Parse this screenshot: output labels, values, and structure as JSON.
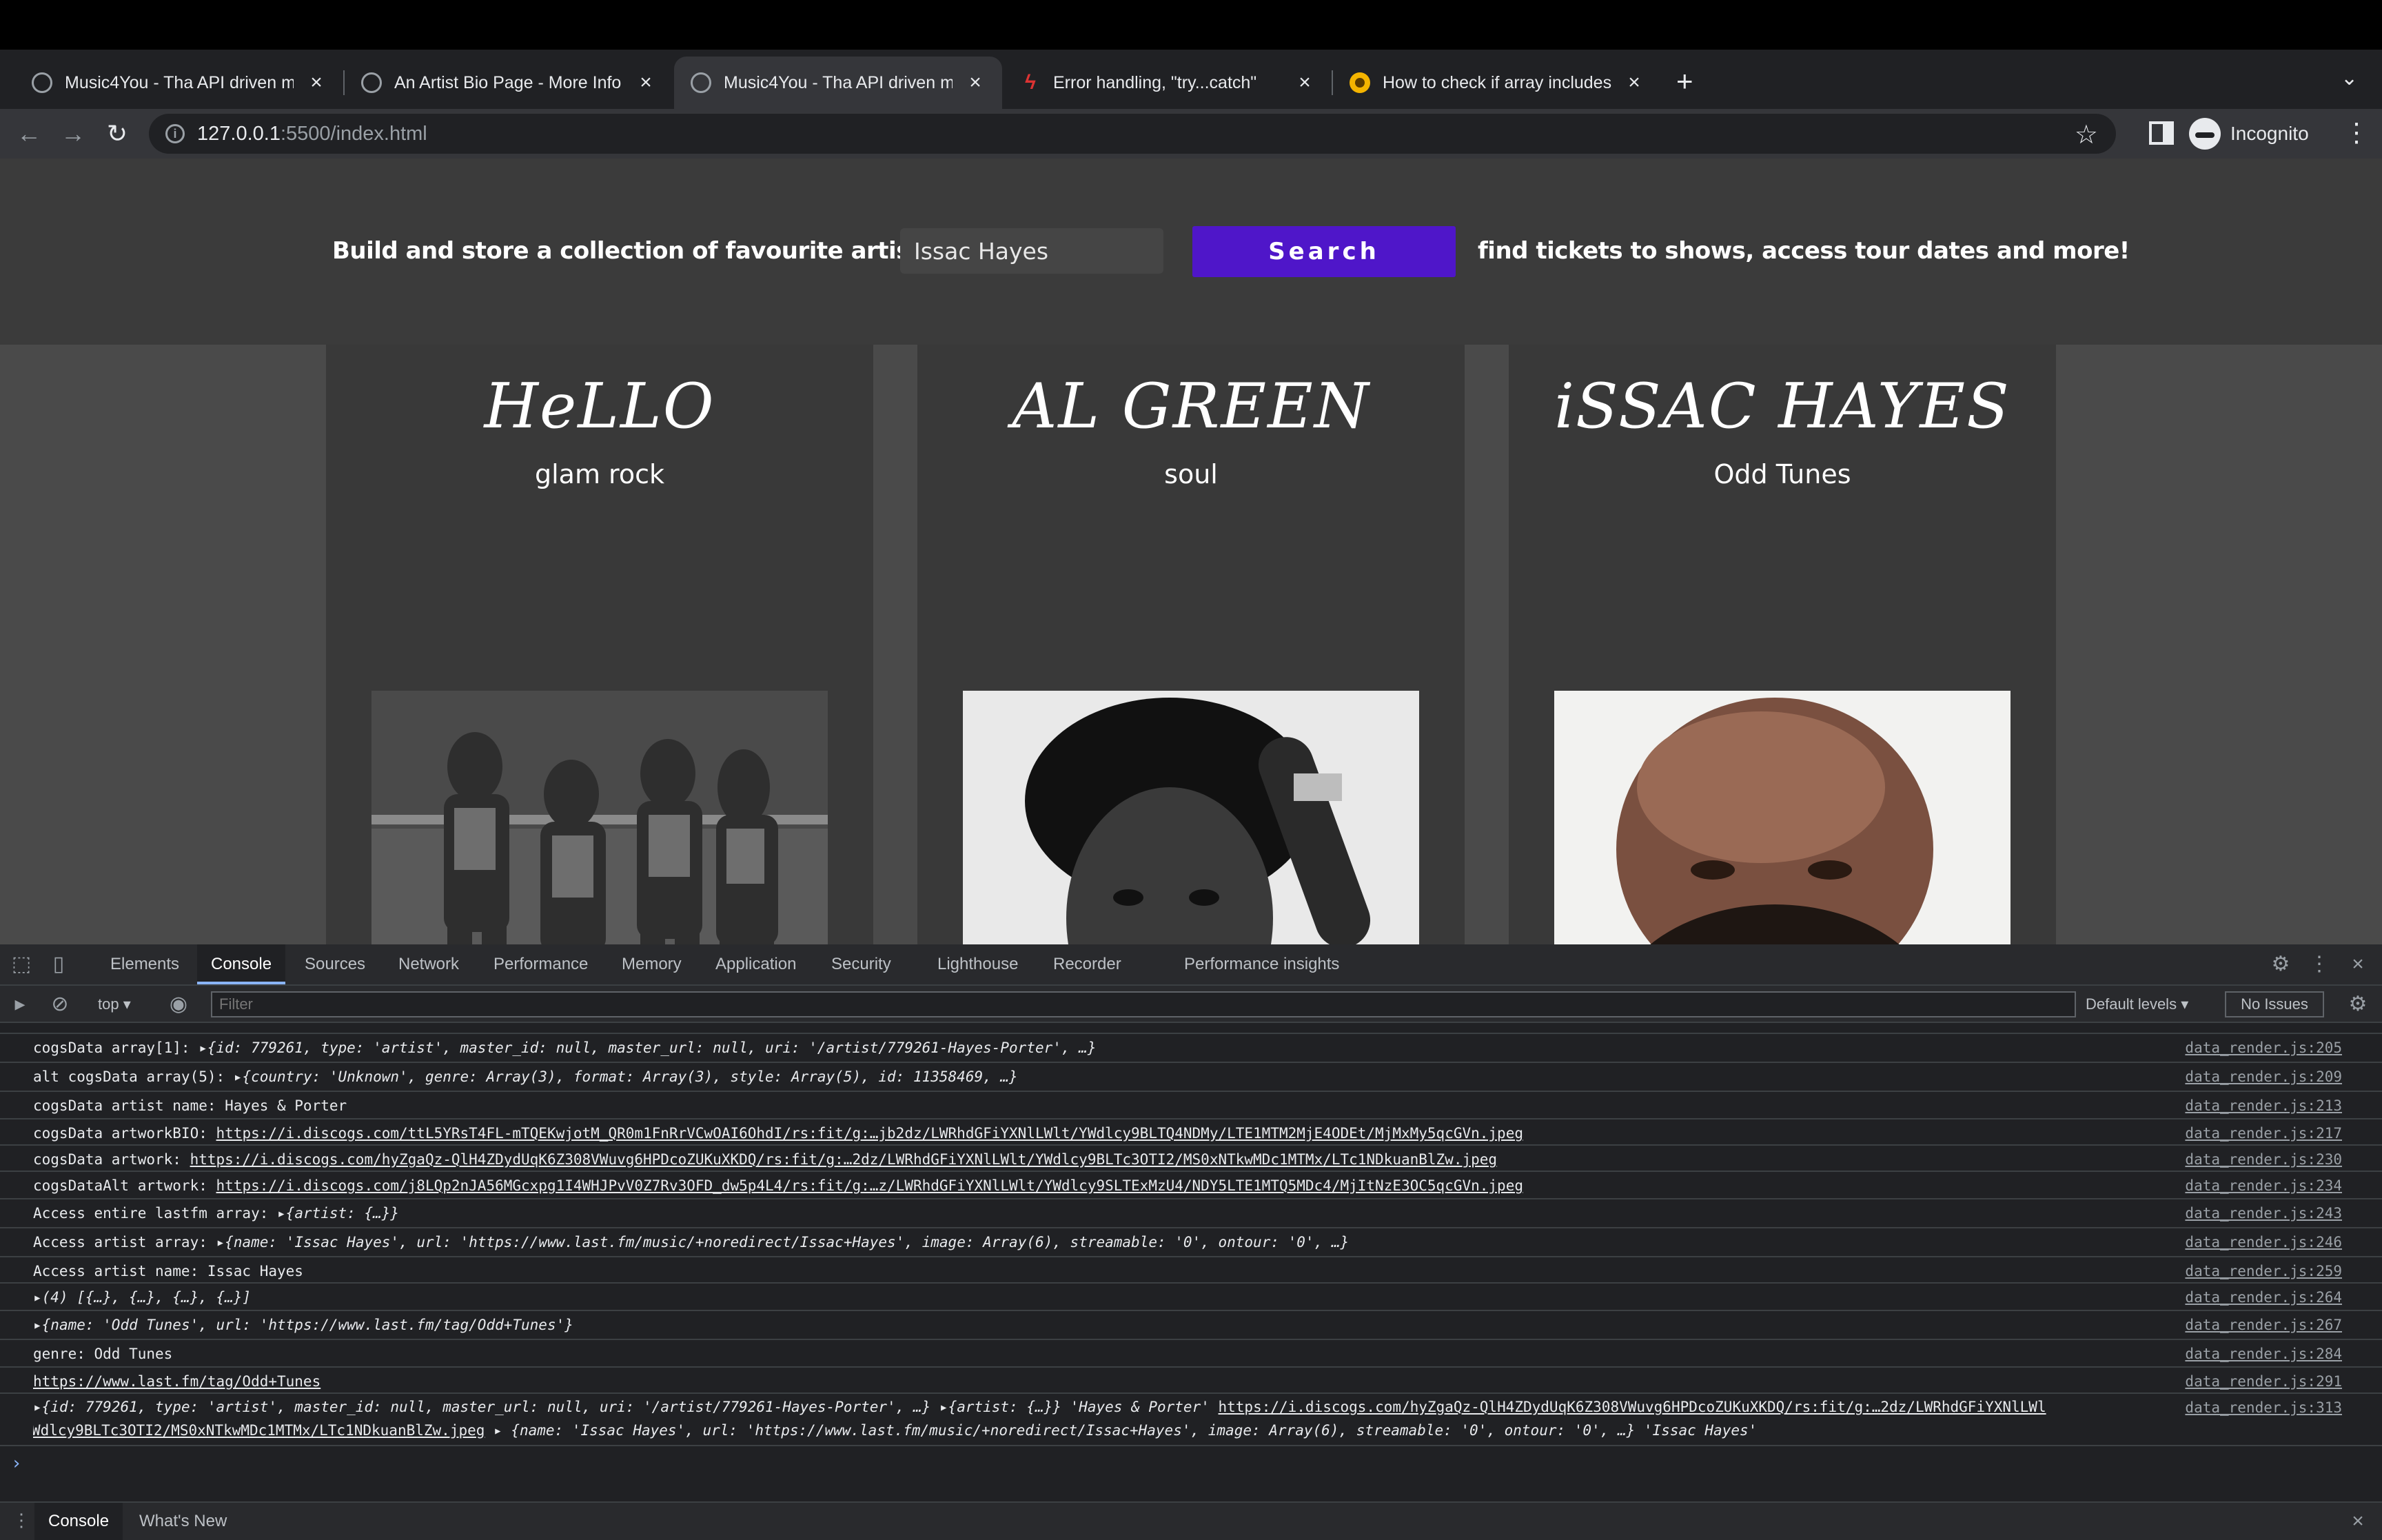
{
  "browser": {
    "tabs": [
      {
        "title": "Music4You - Tha API driven m",
        "favicon": "globe-icon",
        "active": false
      },
      {
        "title": "An Artist Bio Page - More Info",
        "favicon": "globe-icon",
        "active": false
      },
      {
        "title": "Music4You - Tha API driven m",
        "favicon": "globe-icon",
        "active": true
      },
      {
        "title": "Error handling, \"try...catch\"",
        "favicon": "javascript-info-icon",
        "active": false
      },
      {
        "title": "How to check if array includes",
        "favicon": "stackoverflow-icon",
        "active": false
      }
    ],
    "url_host": "127.0.0.1",
    "url_path": ":5500/index.html",
    "incognito_label": "Incognito"
  },
  "page": {
    "tagline_left": "Build and store a collection of favourite artists...",
    "tagline_right": "find tickets to shows, access tour dates and more!",
    "search_value": "Issac Hayes",
    "search_button": "Search",
    "accent_color": "#4f16c9",
    "cards": [
      {
        "name": "HeLLO",
        "genre": "glam rock",
        "photo": "band-photo"
      },
      {
        "name": "AL GREEN",
        "genre": "soul",
        "photo": "al-green-photo"
      },
      {
        "name": "iSSAC HAYES",
        "genre": "Odd Tunes",
        "photo": "issac-hayes-photo"
      }
    ]
  },
  "devtools": {
    "tabs": [
      "Elements",
      "Console",
      "Sources",
      "Network",
      "Performance",
      "Memory",
      "Application",
      "Security",
      "Lighthouse",
      "Recorder",
      "Performance insights"
    ],
    "active_tab": "Console",
    "context": "top",
    "filter_placeholder": "Filter",
    "levels": "Default levels",
    "issues": "No Issues",
    "drawer_tabs": [
      "Console",
      "What's New"
    ],
    "logs": [
      {
        "src": "data_render.js:205"
      },
      {
        "src": "data_render.js:209"
      },
      {
        "src": "data_render.js:213"
      },
      {
        "src": "data_render.js:217"
      },
      {
        "src": "data_render.js:230"
      },
      {
        "src": "data_render.js:234"
      },
      {
        "src": "data_render.js:243"
      },
      {
        "src": "data_render.js:246"
      },
      {
        "src": "data_render.js:259"
      },
      {
        "src": "data_render.js:264"
      },
      {
        "src": "data_render.js:267"
      },
      {
        "src": "data_render.js:284"
      },
      {
        "src": "data_render.js:291"
      },
      {
        "src": "data_render.js:313"
      }
    ],
    "log_text": {
      "l0_label": "cogsData array[1]: ",
      "l0_body": "{id: 779261, type: 'artist', master_id: null, master_url: null, uri: '/artist/779261-Hayes-Porter', …}",
      "l1_label": "alt cogsData array(5): ",
      "l1_body": "{country: 'Unknown', genre: Array(3), format: Array(3), style: Array(5), id: 11358469, …}",
      "l2": "cogsData artist name:  Hayes & Porter",
      "l3_label": "cogsData artworkBIO:  ",
      "l3_url": "https://i.discogs.com/ttL5YRsT4FL-mTQEKwjotM_QR0m1FnRrVCwOAI6OhdI/rs:fit/g:…jb2dz/LWRhdGFiYXNlLWlt/YWdlcy9BLTQ4NDMy/LTE1MTM2MjE4ODEt/MjMxMy5qcGVn.jpeg",
      "l4_label": "cogsData artwork:  ",
      "l4_url": "https://i.discogs.com/hyZgaQz-QlH4ZDydUqK6Z308VWuvg6HPDcoZUKuXKDQ/rs:fit/g:…2dz/LWRhdGFiYXNlLWlt/YWdlcy9BLTc3OTI2/MS0xNTkwMDc1MTMx/LTc1NDkuanBlZw.jpeg",
      "l5_label": "cogsDataAlt artwork:  ",
      "l5_url": "https://i.discogs.com/j8LQp2nJA56MGcxpg1I4WHJPvV0Z7Rv3OFD_dw5p4L4/rs:fit/g:…z/LWRhdGFiYXNlLWlt/YWdlcy9SLTExMzU4/NDY5LTE1MTQ5MDc4/MjItNzE3OC5qcGVn.jpeg",
      "l6_label": "Access entire lastfm array:  ",
      "l6_body": "{artist: {…}}",
      "l7_label": "Access artist array:  ",
      "l7_body": "{name: 'Issac Hayes', url: 'https://www.last.fm/music/+noredirect/Issac+Hayes', image: Array(6), streamable: '0', ontour: '0', …}",
      "l8": "Access artist name:  Issac Hayes",
      "l9": "(4) [{…}, {…}, {…}, {…}]",
      "l10": "{name: 'Odd Tunes', url: 'https://www.last.fm/tag/Odd+Tunes'}",
      "l11": "genre: Odd Tunes",
      "l12": "https://www.last.fm/tag/Odd+Tunes",
      "l13_a": "{id: 779261, type: 'artist', master_id: null, master_url: null, uri: '/artist/779261-Hayes-Porter', …} ",
      "l13_b": "{artist: {…}} 'Hayes & Porter' ",
      "l13_url": "https://i.discogs.com/hyZgaQz-QlH4ZDydUqK6Z308VWuvg6HPDcoZUKuXKDQ/rs:fit/g:…2dz/LWRhdGFiYXNlLWl",
      "l13_url2": "t/YWdlcy9BLTc3OTI2/MS0xNTkwMDc1MTMx/LTc1NDkuanBlZw.jpeg",
      "l13_c": " {name: 'Issac Hayes', url: 'https://www.last.fm/music/+noredirect/Issac+Hayes', image: Array(6), streamable: '0', ontour: '0', …} 'Issac Hayes'"
    }
  }
}
